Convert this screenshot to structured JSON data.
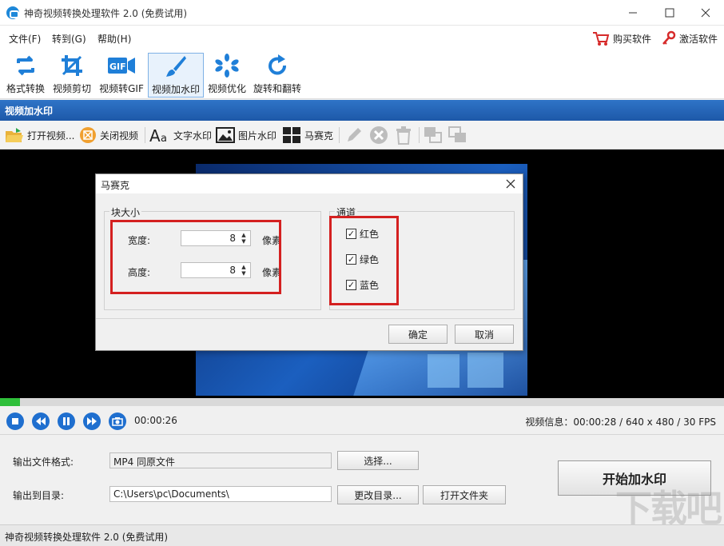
{
  "window": {
    "title": "神奇视频转换处理软件 2.0 (免费试用)"
  },
  "menu": {
    "items": [
      "文件(F)",
      "转到(G)",
      "帮助(H)"
    ],
    "buy_label": "购买软件",
    "activate_label": "激活软件"
  },
  "toolbar": {
    "tools": [
      "格式转换",
      "视频剪切",
      "视频转GIF",
      "视频加水印",
      "视频优化",
      "旋转和翻转"
    ]
  },
  "section": {
    "title": "视频加水印"
  },
  "subtoolbar": {
    "open": "打开视频...",
    "close": "关闭视频",
    "text_watermark": "文字水印",
    "image_watermark": "图片水印",
    "mosaic": "马赛克"
  },
  "player": {
    "time": "00:00:26",
    "info": "视频信息：00:00:28 / 640 x 480 / 30 FPS",
    "progress_fraction": 0.028
  },
  "output": {
    "format_label": "输出文件格式:",
    "format_value": "MP4 同原文件",
    "select_button": "选择...",
    "dir_label": "输出到目录:",
    "dir_value": "C:\\Users\\pc\\Documents\\",
    "change_dir_button": "更改目录...",
    "open_folder_button": "打开文件夹",
    "start_button": "开始加水印"
  },
  "statusbar": {
    "text": "神奇视频转换处理软件 2.0 (免费试用)"
  },
  "dialog": {
    "title": "马赛克",
    "block_group": "块大小",
    "width_label": "宽度:",
    "width_value": "8",
    "width_unit": "像素",
    "height_label": "高度:",
    "height_value": "8",
    "height_unit": "像素",
    "channel_group": "通道",
    "channels": [
      "红色",
      "绿色",
      "蓝色"
    ],
    "ok": "确定",
    "cancel": "取消"
  },
  "colors": {
    "accent": "#1f6fcf",
    "highlight": "#d42020",
    "progress": "#2fbf3a"
  }
}
